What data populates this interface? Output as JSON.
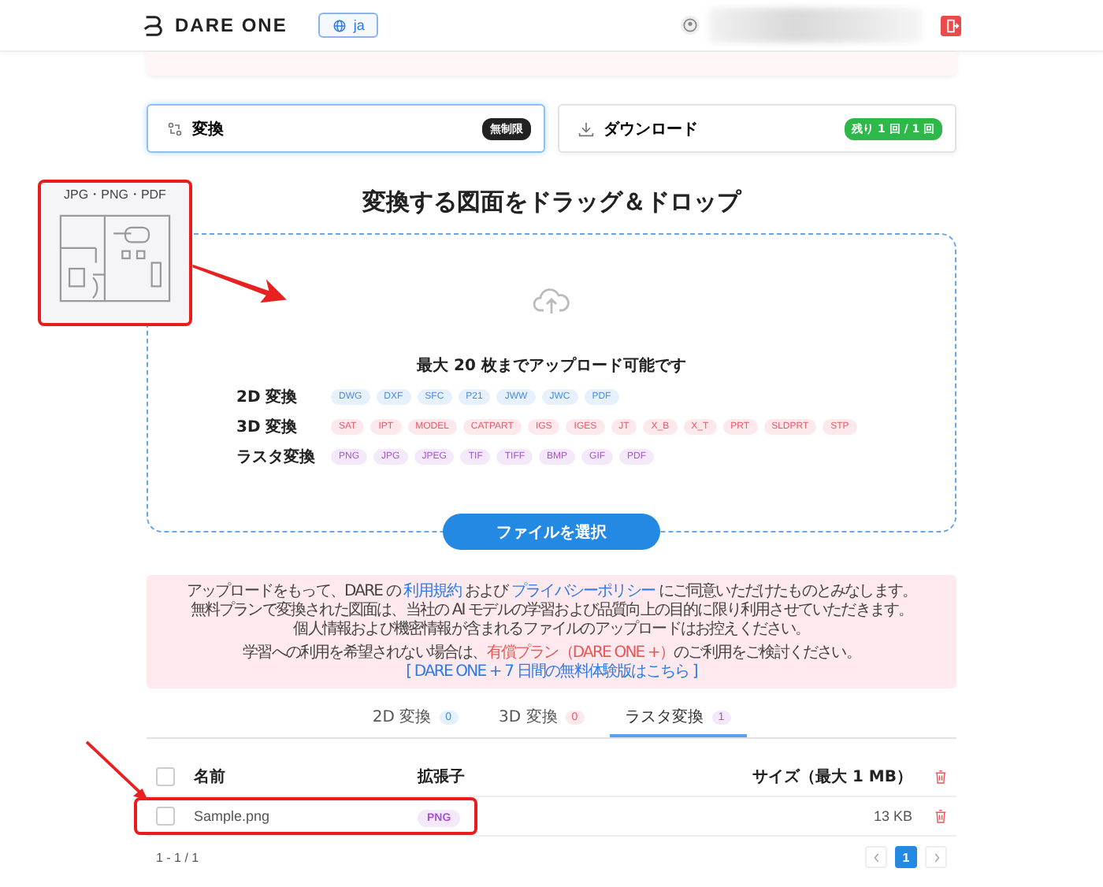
{
  "header": {
    "logo": "DARE ONE",
    "language": "ja"
  },
  "mode_cards": [
    {
      "kind": "convert",
      "label": "変換",
      "badge": "無制限",
      "selected": true
    },
    {
      "kind": "download",
      "label": "ダウンロード",
      "badge": "残り 1 回 / 1 回",
      "selected": false
    }
  ],
  "title": "変換する図面をドラッグ＆ドロップ",
  "preview": {
    "caption": "JPG・PNG・PDF"
  },
  "upload": {
    "limit": "最大 20 枚までアップロード可能です",
    "groups": [
      {
        "kind": "flat",
        "label": "2D 変換",
        "formats": [
          "DWG",
          "DXF",
          "SFC",
          "P21",
          "JWW",
          "JWC",
          "PDF"
        ]
      },
      {
        "kind": "solid",
        "label": "3D 変換",
        "formats": [
          "SAT",
          "IPT",
          "MODEL",
          "CATPART",
          "IGS",
          "IGES",
          "JT",
          "X_B",
          "X_T",
          "PRT",
          "SLDPRT",
          "STP"
        ]
      },
      {
        "kind": "raster",
        "label": "ラスタ変換",
        "formats": [
          "PNG",
          "JPG",
          "JPEG",
          "TIF",
          "TIFF",
          "BMP",
          "GIF",
          "PDF"
        ]
      }
    ],
    "button": "ファイルを選択"
  },
  "notice": {
    "lines": [
      [
        {
          "kind": "text",
          "text": "アップロードをもって、DARE の "
        },
        {
          "kind": "link",
          "text": "利用規約"
        },
        {
          "kind": "text",
          "text": " および "
        },
        {
          "kind": "link",
          "text": "プライバシーポリシー"
        },
        {
          "kind": "text",
          "text": " にご同意いただけたものとみなします。"
        }
      ],
      [
        {
          "kind": "text",
          "text": "無料プランで変換された図面は、当社の AI モデルの学習および品質向上の目的に限り利用させていただきます。"
        }
      ],
      [
        {
          "kind": "text",
          "text": "個人情報および機密情報が含まれるファイルのアップロードはお控えください。"
        }
      ],
      [
        {
          "kind": "text",
          "text": "学習への利用を希望されない場合は、"
        },
        {
          "kind": "plan",
          "text": "有償プラン（DARE ONE +）"
        },
        {
          "kind": "text",
          "text": "のご利用をご検討ください。"
        }
      ],
      [
        {
          "kind": "link",
          "text": "[ DARE ONE + 7 日間の無料体験版はこちら ]"
        }
      ]
    ]
  },
  "file_tabs": [
    {
      "kind": "flat",
      "label": "2D 変換",
      "count": "0",
      "selected": false
    },
    {
      "kind": "solid",
      "label": "3D 変換",
      "count": "0",
      "selected": false
    },
    {
      "kind": "raster",
      "label": "ラスタ変換",
      "count": "1",
      "selected": true
    }
  ],
  "table": {
    "columns": [
      "名前",
      "拡張子",
      "サイズ（最大 1 MB）"
    ],
    "all_checked": false,
    "rows": [
      {
        "name": "Sample.png",
        "ext": "PNG",
        "size": "13 KB",
        "checked": false
      }
    ]
  },
  "pagination": {
    "range": "1 - 1 / 1",
    "pages": [
      {
        "label": "1",
        "selected": true
      }
    ]
  }
}
